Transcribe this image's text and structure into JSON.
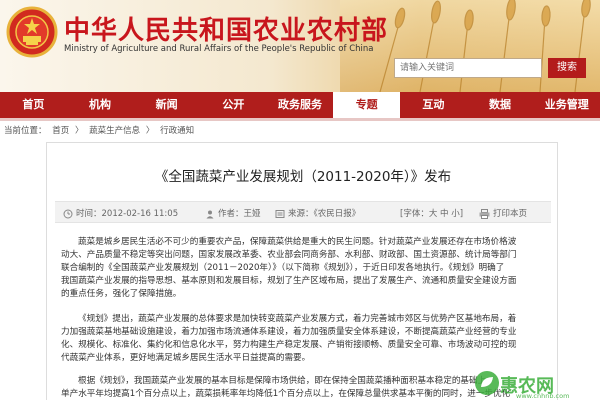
{
  "header": {
    "title": "中华人民共和国农业农村部",
    "subtitle": "Ministry of Agriculture and Rural Affairs of the People's Republic of China",
    "search_placeholder": "请输入关键词",
    "search_button": "搜索"
  },
  "nav": {
    "items": [
      "首页",
      "机构",
      "新闻",
      "公开",
      "政务服务",
      "专题",
      "互动",
      "数据",
      "业务管理"
    ],
    "active_index": 5
  },
  "breadcrumb": [
    "当前位置：",
    "首页",
    "〉",
    "蔬菜生产信息",
    "〉",
    "行政通知"
  ],
  "article": {
    "title": "《全国蔬菜产业发展规划（2011-2020年）》发布",
    "date": "时间：2012-02-16 11:05",
    "author": "作者：王娅",
    "source": "来源：《农民日报》",
    "font_size": "[字体：大 中 小]",
    "print": "打印本页",
    "paragraph1": [
      "蔬菜是城乡居民生活必不可少的重要农产品，保障蔬菜供给是重大的民生问题。针对蔬菜产业发展还存在市场价格波",
      "动大、产品质量不稳定等突出问题，国家发展改革委、农业部会同商务部、水利部、财政部、国土资源部、统计局等部门",
      "联合编制的《全国蔬菜产业发展规划（2011－2020年）》（以下简称《规划》），于近日印发各地执行。《规划》明确了",
      "我国蔬菜产业发展的指导思想、基本原则和发展目标，规划了生产区域布局，提出了发展生产、流通和质量安全建设方面",
      "的重点任务，强化了保障措施。"
    ],
    "paragraph2": [
      "《规划》提出，蔬菜产业发展的总体要求是加快转变蔬菜产业发展方式，着力完善城市郊区与优势产区基地布局，着",
      "力加强蔬菜基地基础设施建设，着力加强市场流通体系建设，着力加强质量安全体系建设，不断提高蔬菜产业经营的专业",
      "化、规模化、标准化、集约化和信息化水平，努力构建生产稳定发展、产销衔接顺畅、质量安全可靠、市场波动可控的现",
      "代蔬菜产业体系，更好地满足城乡居民生活水平日益提高的需要。"
    ],
    "paragraph3": [
      "根据《规划》，我国蔬菜产业发展的基本目标是保障市场供给，即在保持全国蔬菜播种面积基本稳定的基础上，",
      "单产水平年均提高1个百分点以上，蔬菜损耗率年均降低1个百分点以上，在保障总量供求基本平衡的同时，进一步优化"
    ]
  },
  "watermark": {
    "text": "惠农网",
    "url": "www.cnhnb.com"
  },
  "colors": {
    "brand_red": "#b01e1c",
    "title_red": "#c8161d",
    "watermark_green": "#3cae3c"
  }
}
